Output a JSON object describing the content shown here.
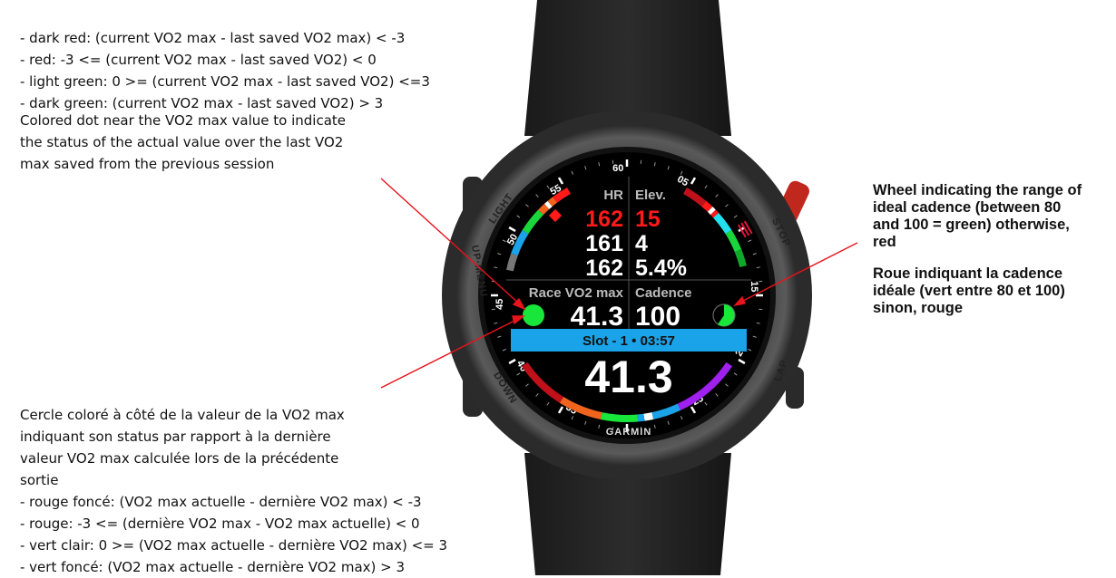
{
  "annotations": {
    "thresholds_en": [
      "- dark red: (current VO2 max - last saved VO2 max) < -3",
      "- red: -3 <= (current VO2 max - last saved VO2) < 0",
      "- light green: 0 >= (current VO2 max - last saved VO2) <=3",
      "- dark green: (current VO2 max - last saved VO2) > 3"
    ],
    "dot_en": [
      "Colored dot near the VO2 max value to indicate",
      "the status of the actual value over the last VO2",
      "max saved from the previous session"
    ],
    "dot_fr": [
      "Cercle coloré à côté de la valeur de la VO2 max",
      "indiquant son status par rapport à la dernière",
      "valeur VO2 max calculée lors de la précédente",
      "sortie",
      "- rouge foncé: (VO2 max actuelle - dernière VO2 max) < -3",
      "- rouge: -3 <= (dernière  VO2 max - VO2 max actuelle) < 0",
      "- vert clair: 0 >= (VO2 max actuelle - dernière VO2 max) <= 3",
      "- vert foncé: (VO2 max actuelle - dernière VO2 max) > 3"
    ],
    "wheel_en": [
      "Wheel indicating the range of",
      "ideal cadence (between 80",
      "and 100 = green) otherwise,",
      "red"
    ],
    "wheel_fr": [
      "Roue indiquant la cadence",
      "idéale (vert entre 80 et 100)",
      "sinon, rouge"
    ],
    "arrow_color": "#e8141c"
  },
  "watch": {
    "brand": "GARMIN",
    "buttons": {
      "light": "LIGHT",
      "up_menu": "UP·MENU",
      "down": "DOWN",
      "stop": "STOP",
      "lap": "LAP"
    },
    "dial_numbers": [
      "60",
      "05",
      "15",
      "20",
      "25",
      "35",
      "40",
      "45",
      "50",
      "55"
    ],
    "hr_label": "HR",
    "elev_label": "Elev.",
    "hr_values": [
      "162",
      "161",
      "162"
    ],
    "elev_values": [
      "15",
      "4",
      "5.4%"
    ],
    "vo2_label": "Race VO2 max",
    "vo2_value": "41.3",
    "cadence_label": "Cadence",
    "cadence_value": "100",
    "slot_bar": "Slot - 1 • 03:57",
    "main_value": "41.3",
    "vo2_status_color": "#19e63a",
    "cadence_wheel_color": "#19e63a",
    "slot_bar_color": "#1aa3e8",
    "alert_color": "#ff1a1a"
  }
}
